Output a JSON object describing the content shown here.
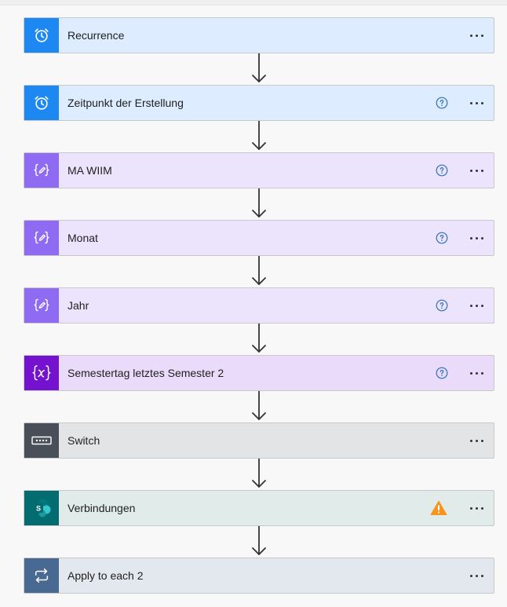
{
  "steps": [
    {
      "name": "recurrence",
      "title": "Recurrence",
      "icon": "alarm-clock-icon",
      "theme": "blue",
      "help": false,
      "warning": false
    },
    {
      "name": "zeitpunkt-der-erstellung",
      "title": "Zeitpunkt der Erstellung",
      "icon": "alarm-clock-icon",
      "theme": "blue",
      "help": true,
      "warning": false
    },
    {
      "name": "ma-wiim",
      "title": "MA WIIM",
      "icon": "variable-edit-icon",
      "theme": "purple",
      "help": true,
      "warning": false
    },
    {
      "name": "monat",
      "title": "Monat",
      "icon": "variable-edit-icon",
      "theme": "purple",
      "help": true,
      "warning": false
    },
    {
      "name": "jahr",
      "title": "Jahr",
      "icon": "variable-edit-icon",
      "theme": "purple",
      "help": true,
      "warning": false
    },
    {
      "name": "semestertag-letztes-semester-2",
      "title": "Semestertag letztes Semester 2",
      "icon": "variable-x-icon",
      "theme": "violet",
      "help": true,
      "warning": false
    },
    {
      "name": "switch",
      "title": "Switch",
      "icon": "switch-icon",
      "theme": "gray",
      "help": false,
      "warning": false
    },
    {
      "name": "verbindungen",
      "title": "Verbindungen",
      "icon": "sharepoint-icon",
      "theme": "teal",
      "help": false,
      "warning": true
    },
    {
      "name": "apply-to-each-2",
      "title": "Apply to each 2",
      "icon": "loop-icon",
      "theme": "slate",
      "help": false,
      "warning": false
    }
  ],
  "colors": {
    "help": "#2f6fbf",
    "warning": "#f7941d",
    "arrow": "#333333"
  }
}
